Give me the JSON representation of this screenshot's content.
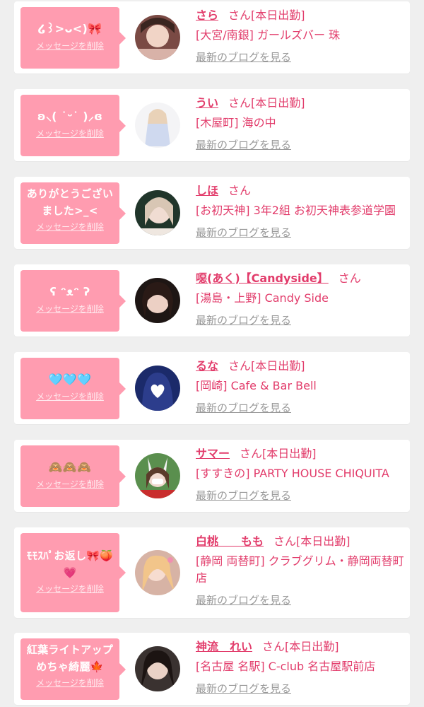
{
  "delete_label": "メッセージを削除",
  "blog_label": "最新のブログを見る",
  "san_label": "さん",
  "colors": {
    "accent": "#e23c6b",
    "bubble": "#ff9cb0",
    "background": "#efefef",
    "muted": "#999999"
  },
  "cards": [
    {
      "message": "໒꒱>ᴗ<)🎀",
      "name": "さら",
      "status": "[本日出勤]",
      "shop": "[大宮/南銀] ガールズバー 珠"
    },
    {
      "message": "ʚ⸜( ˙ᵕ˙ )⸝ɞ",
      "name": "うい",
      "status": "[本日出勤]",
      "shop": "[木屋町] 海の中"
    },
    {
      "message": "ありがとうござい\nました>_<",
      "name": "しほ",
      "status": "",
      "shop": "[お初天神] 3年2組 お初天神表参道学園"
    },
    {
      "message": "ʕ ᵔᴥᵔ ʔ",
      "name": "噁(あく)【Candyside】",
      "status": "",
      "shop": "[湯島・上野] Candy Side"
    },
    {
      "message": "🩵🩵🩵",
      "name": "るな",
      "status": "[本日出勤]",
      "shop": "[岡崎] Cafe & Bar Bell"
    },
    {
      "message": "🙈🙈🙈",
      "name": "サマー",
      "status": "[本日出勤]",
      "shop": "[すすきの] PARTY HOUSE CHIQUITA"
    },
    {
      "message": "ﾓﾓｽﾊﾟお返し🎀🍑\n💗",
      "name": "白桃　　もも",
      "status": "[本日出勤]",
      "shop": "[静岡 両替町] クラブグリム・静岡両替町店"
    },
    {
      "message": "紅葉ライトアップ\nめちゃ綺麗🍁",
      "name": "神流　れい",
      "status": "[本日出勤]",
      "shop": "[名古屋 名駅] C-club 名古屋駅前店"
    }
  ]
}
